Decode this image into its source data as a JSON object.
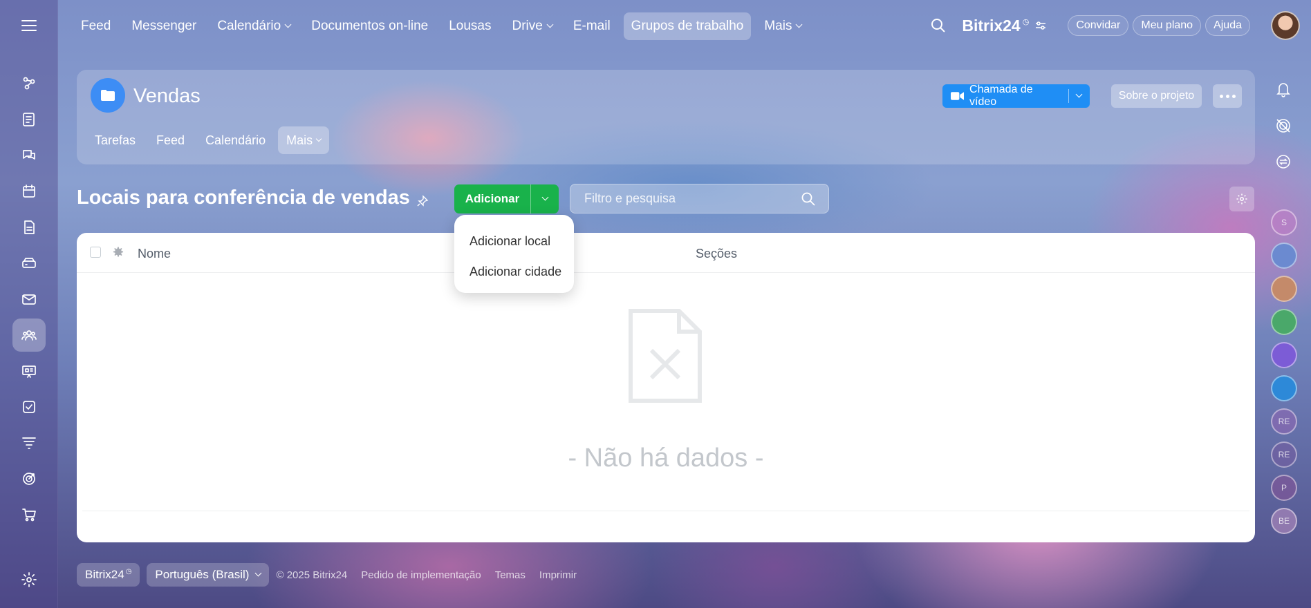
{
  "top_nav": {
    "items": [
      {
        "label": "Feed",
        "has_dropdown": false
      },
      {
        "label": "Messenger",
        "has_dropdown": false
      },
      {
        "label": "Calendário",
        "has_dropdown": true
      },
      {
        "label": "Documentos on-line",
        "has_dropdown": false
      },
      {
        "label": "Lousas",
        "has_dropdown": false
      },
      {
        "label": "Drive",
        "has_dropdown": true
      },
      {
        "label": "E-mail",
        "has_dropdown": false
      },
      {
        "label": "Grupos de trabalho",
        "has_dropdown": false,
        "active": true
      },
      {
        "label": "Mais",
        "has_dropdown": true
      }
    ],
    "brand": "Bitrix24",
    "invite_label": "Convidar",
    "plan_label": "Meu plano",
    "help_label": "Ajuda"
  },
  "project": {
    "title": "Vendas",
    "tabs": [
      "Tarefas",
      "Feed",
      "Calendário",
      "Mais"
    ],
    "active_tab": "Mais",
    "video_call_label": "Chamada de vídeo",
    "about_label": "Sobre o projeto"
  },
  "toolbar": {
    "page_title": "Locais para conferência de vendas",
    "add_label": "Adicionar",
    "filter_placeholder": "Filtro e pesquisa"
  },
  "dropdown": {
    "options": [
      "Adicionar local",
      "Adicionar cidade"
    ]
  },
  "grid": {
    "columns": [
      "Nome",
      "Seções"
    ],
    "empty_text": "- Não há dados -"
  },
  "right_rail": {
    "avatars": [
      "S",
      "",
      "",
      "",
      "",
      "",
      "RE",
      "RE",
      "P",
      "BE"
    ]
  },
  "footer": {
    "brand": "Bitrix24",
    "language": "Português (Brasil)",
    "links": [
      "© 2025 Bitrix24",
      "Pedido de implementação",
      "Temas",
      "Imprimir"
    ]
  },
  "colors": {
    "accent_green": "#19b24b",
    "accent_blue": "#1f8ef5",
    "project_icon": "#3d8df5"
  }
}
